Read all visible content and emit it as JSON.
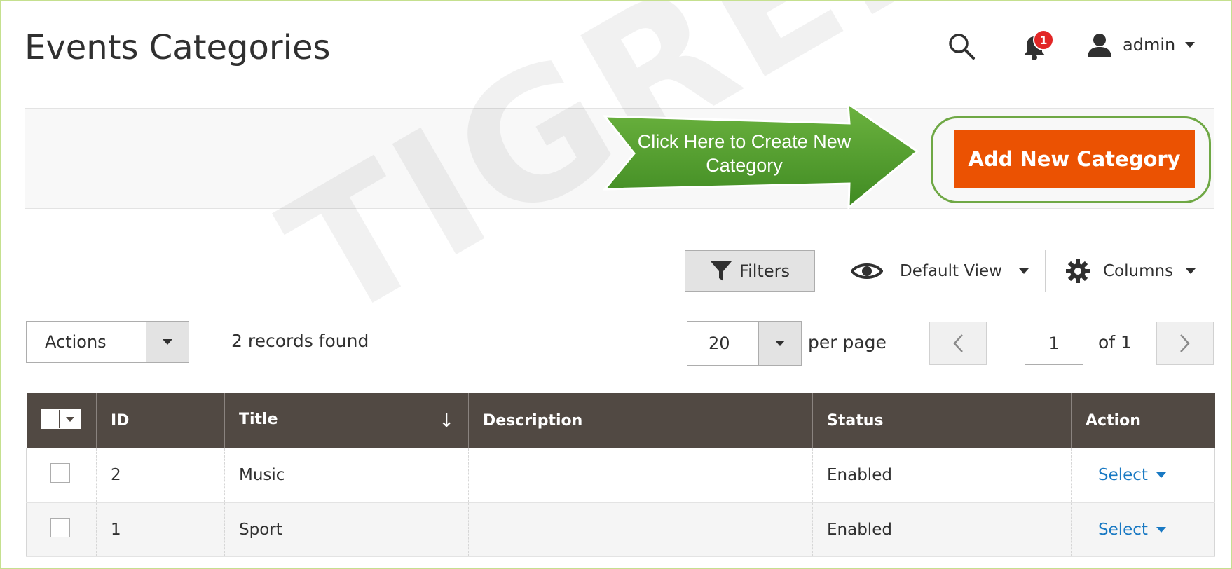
{
  "page": {
    "title": "Events Categories"
  },
  "header": {
    "notification_count": "1",
    "user_name": "admin"
  },
  "page_actions": {
    "callout_text": "Click Here to Create New Category",
    "add_button_label": "Add New Category"
  },
  "watermark": "TIGREN",
  "toolbar": {
    "filters_label": "Filters",
    "view_label": "Default View",
    "columns_label": "Columns"
  },
  "grid_controls": {
    "actions_label": "Actions",
    "records_found": "2 records found",
    "per_page_value": "20",
    "per_page_label": "per page",
    "current_page": "1",
    "page_total": "of 1"
  },
  "table": {
    "columns": [
      "ID",
      "Title",
      "Description",
      "Status",
      "Action"
    ],
    "rows": [
      {
        "id": "2",
        "title": "Music",
        "description": "",
        "status": "Enabled",
        "action": "Select"
      },
      {
        "id": "1",
        "title": "Sport",
        "description": "",
        "status": "Enabled",
        "action": "Select"
      }
    ]
  },
  "colors": {
    "accent": "#eb5202",
    "header_bg": "#514943",
    "callout_green": "#4e9a2a",
    "link": "#1979c3",
    "badge": "#e22626"
  },
  "icons": [
    "search-icon",
    "bell-icon",
    "user-icon",
    "filter-icon",
    "eye-icon",
    "gear-icon",
    "chevron-left-icon",
    "chevron-right-icon",
    "caret-down-icon",
    "sort-down-arrow-icon"
  ]
}
